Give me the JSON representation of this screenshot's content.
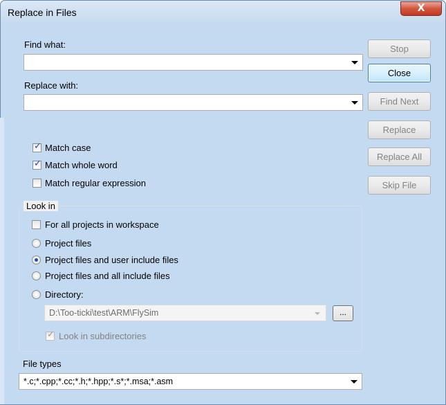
{
  "window": {
    "title": "Replace in Files",
    "close_glyph": "X"
  },
  "find": {
    "label": "Find what:",
    "value": ""
  },
  "replace": {
    "label": "Replace with:",
    "value": ""
  },
  "buttons": {
    "stop": "Stop",
    "close": "Close",
    "find_next": "Find Next",
    "replace": "Replace",
    "replace_all": "Replace All",
    "skip_file": "Skip File"
  },
  "options": {
    "match_case": {
      "label": "Match case",
      "checked": true
    },
    "match_whole_word": {
      "label": "Match whole word",
      "checked": true
    },
    "match_regex": {
      "label": "Match regular expression",
      "checked": false
    }
  },
  "look_in": {
    "title": "Look in",
    "all_projects": {
      "label": "For all projects in workspace",
      "checked": false
    },
    "radios": [
      {
        "label": "Project files",
        "selected": false
      },
      {
        "label": "Project files and user include files",
        "selected": true
      },
      {
        "label": "Project files and all include files",
        "selected": false
      },
      {
        "label": "Directory:",
        "selected": false
      }
    ],
    "directory_value": "D:\\Too-ticki\\test\\ARM\\FlySim",
    "browse_label": "...",
    "subdirectories": {
      "label": "Look in subdirectories",
      "checked": true,
      "enabled": false
    }
  },
  "file_types": {
    "label": "File types",
    "value": "*.c;*.cpp;*.cc;*.h;*.hpp;*.s*;*.msa;*.asm"
  },
  "colors": {
    "accent": "#3c7fb1",
    "titlebar": "#c4daf0",
    "close": "#c23a23"
  }
}
